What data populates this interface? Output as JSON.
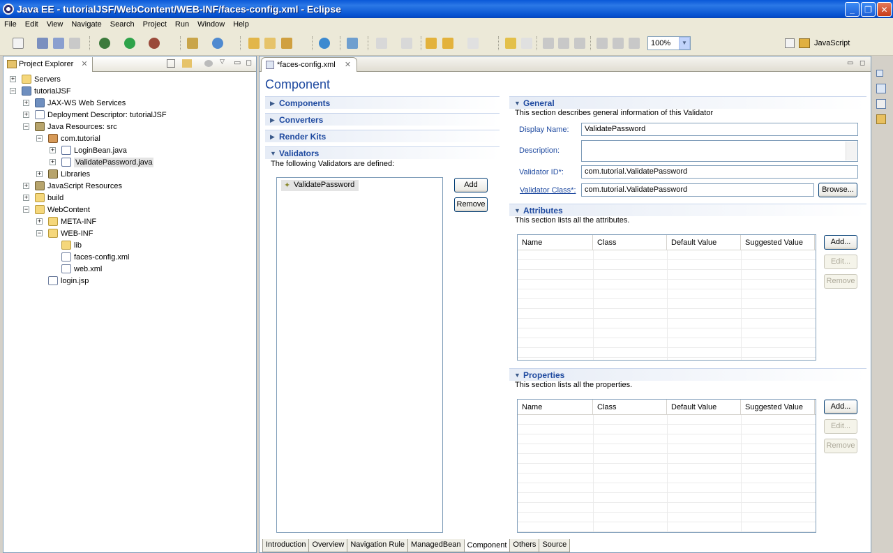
{
  "window": {
    "title": "Java EE - tutorialJSF/WebContent/WEB-INF/faces-config.xml - Eclipse"
  },
  "menu": [
    "File",
    "Edit",
    "View",
    "Navigate",
    "Search",
    "Project",
    "Run",
    "Window",
    "Help"
  ],
  "toolbar": {
    "zoom": "100%",
    "perspective": "JavaScript"
  },
  "explorer": {
    "tab_label": "Project Explorer",
    "items": [
      {
        "label": "Servers"
      },
      {
        "label": "tutorialJSF"
      },
      {
        "label": "JAX-WS Web Services"
      },
      {
        "label": "Deployment Descriptor: tutorialJSF"
      },
      {
        "label": "Java Resources: src"
      },
      {
        "label": "com.tutorial"
      },
      {
        "label": "LoginBean.java"
      },
      {
        "label": "ValidatePassword.java"
      },
      {
        "label": "Libraries"
      },
      {
        "label": "JavaScript Resources"
      },
      {
        "label": "build"
      },
      {
        "label": "WebContent"
      },
      {
        "label": "META-INF"
      },
      {
        "label": "WEB-INF"
      },
      {
        "label": "lib"
      },
      {
        "label": "faces-config.xml"
      },
      {
        "label": "web.xml"
      },
      {
        "label": "login.jsp"
      }
    ]
  },
  "editor": {
    "tab_label": "*faces-config.xml",
    "form_title": "Component",
    "sections": {
      "components": "Components",
      "converters": "Converters",
      "render_kits": "Render Kits",
      "validators": "Validators",
      "validators_desc": "The following Validators are defined:",
      "validator_items": [
        "ValidatePassword"
      ],
      "add_label": "Add",
      "remove_label": "Remove"
    },
    "general": {
      "title": "General",
      "desc": "This section describes general information of this Validator",
      "display_name_label": "Display Name:",
      "display_name_value": "ValidatePassword",
      "description_label": "Description:",
      "description_value": "",
      "validator_id_label": "Validator ID*:",
      "validator_id_value": "com.tutorial.ValidatePassword",
      "validator_class_label": "Validator Class*:",
      "validator_class_value": "com.tutorial.ValidatePassword",
      "browse_label": "Browse..."
    },
    "attributes": {
      "title": "Attributes",
      "desc": "This section lists all the attributes.",
      "columns": [
        "Name",
        "Class",
        "Default Value",
        "Suggested Value"
      ],
      "add_label": "Add...",
      "edit_label": "Edit...",
      "remove_label": "Remove"
    },
    "properties": {
      "title": "Properties",
      "desc": "This section lists all the properties.",
      "columns": [
        "Name",
        "Class",
        "Default Value",
        "Suggested Value"
      ],
      "add_label": "Add...",
      "edit_label": "Edit...",
      "remove_label": "Remove"
    },
    "bottom_tabs": [
      "Introduction",
      "Overview",
      "Navigation Rule",
      "ManagedBean",
      "Component",
      "Others",
      "Source"
    ],
    "active_bottom_tab": "Component"
  }
}
